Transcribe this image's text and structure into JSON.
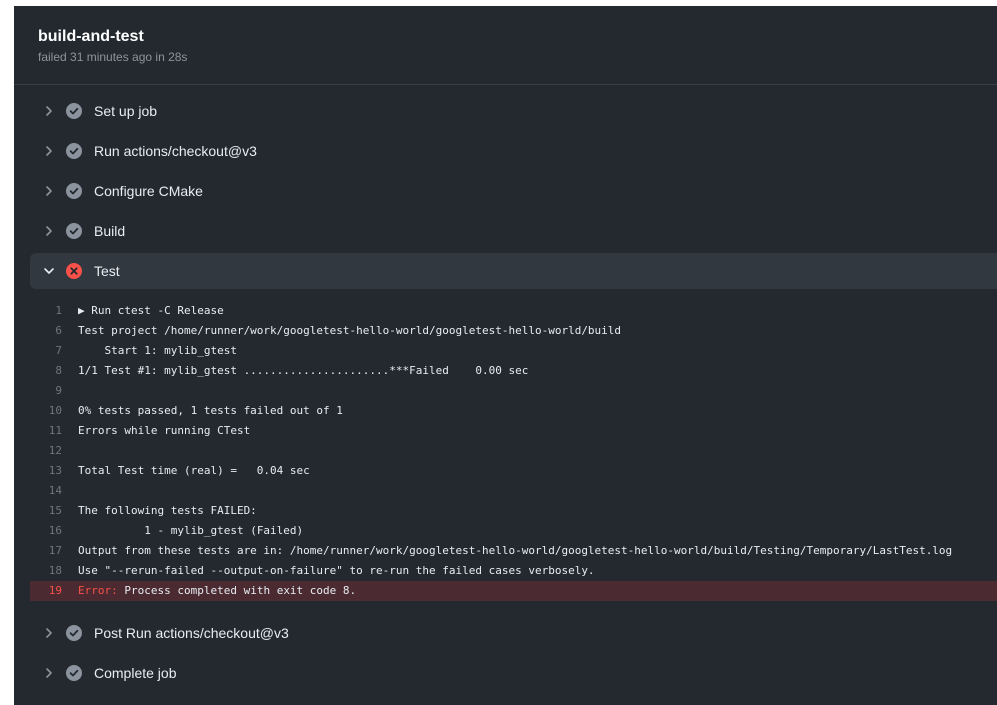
{
  "job": {
    "title": "build-and-test",
    "meta": "failed 31 minutes ago in 28s"
  },
  "steps_before": [
    {
      "name": "Set up job",
      "status": "success"
    },
    {
      "name": "Run actions/checkout@v3",
      "status": "success"
    },
    {
      "name": "Configure CMake",
      "status": "success"
    },
    {
      "name": "Build",
      "status": "success"
    }
  ],
  "open_step": {
    "name": "Test",
    "status": "failure"
  },
  "log": [
    {
      "n": "1",
      "text": "▶ Run ctest -C Release"
    },
    {
      "n": "6",
      "text": "Test project /home/runner/work/googletest-hello-world/googletest-hello-world/build"
    },
    {
      "n": "7",
      "text": "    Start 1: mylib_gtest"
    },
    {
      "n": "8",
      "text": "1/1 Test #1: mylib_gtest ......................***Failed    0.00 sec"
    },
    {
      "n": "9",
      "text": ""
    },
    {
      "n": "10",
      "text": "0% tests passed, 1 tests failed out of 1"
    },
    {
      "n": "11",
      "text": "Errors while running CTest"
    },
    {
      "n": "12",
      "text": ""
    },
    {
      "n": "13",
      "text": "Total Test time (real) =   0.04 sec"
    },
    {
      "n": "14",
      "text": ""
    },
    {
      "n": "15",
      "text": "The following tests FAILED:"
    },
    {
      "n": "16",
      "text": "\t  1 - mylib_gtest (Failed)"
    },
    {
      "n": "17",
      "text": "Output from these tests are in: /home/runner/work/googletest-hello-world/googletest-hello-world/build/Testing/Temporary/LastTest.log"
    },
    {
      "n": "18",
      "text": "Use \"--rerun-failed --output-on-failure\" to re-run the failed cases verbosely."
    }
  ],
  "error_line": {
    "n": "19",
    "label": "Error:",
    "text": " Process completed with exit code 8."
  },
  "steps_after": [
    {
      "name": "Post Run actions/checkout@v3",
      "status": "success"
    },
    {
      "name": "Complete job",
      "status": "success"
    }
  ],
  "colors": {
    "success": "#8b949e",
    "failure": "#f85149"
  },
  "icons": {
    "collapsed": "chevron-right-icon",
    "expanded": "chevron-down-icon",
    "success": "check-circle-icon",
    "failure": "x-circle-icon"
  }
}
